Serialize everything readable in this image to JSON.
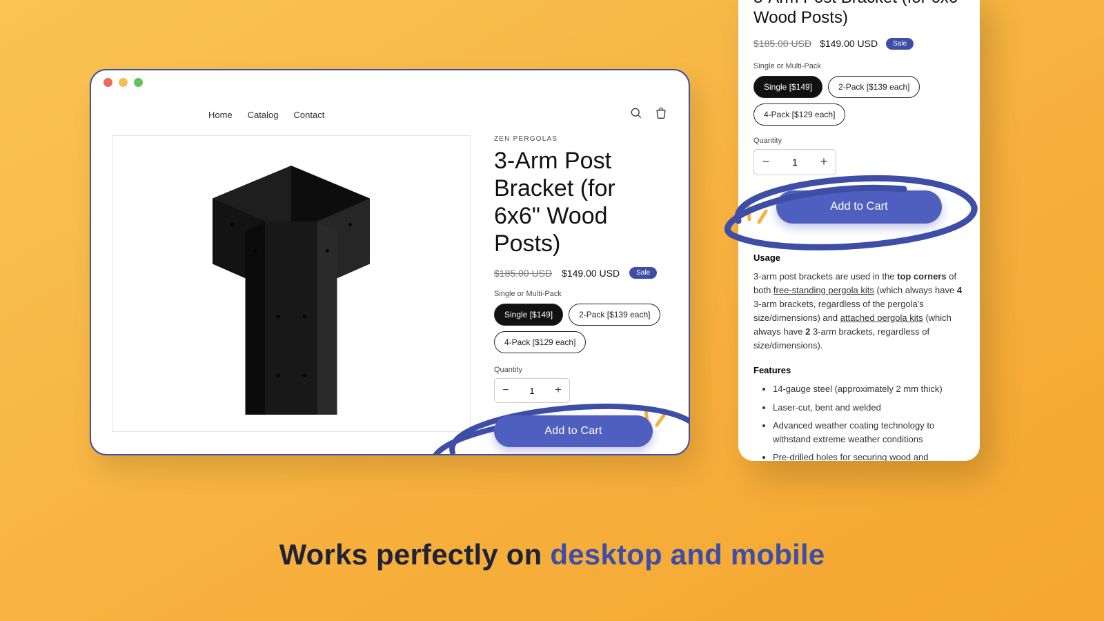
{
  "nav": {
    "home": "Home",
    "catalog": "Catalog",
    "contact": "Contact"
  },
  "product": {
    "vendor": "ZEN PERGOLAS",
    "title": "3-Arm Post Bracket (for 6x6\" Wood Posts)",
    "price_old": "$185.00 USD",
    "price_new": "$149.00 USD",
    "sale_badge": "Sale",
    "variant_label": "Single or Multi-Pack",
    "variants": {
      "single": "Single [$149]",
      "pack2": "2-Pack [$139 each]",
      "pack4": "4-Pack [$129 each]"
    },
    "qty_label": "Quantity",
    "qty_value": "1",
    "add_to_cart": "Add to Cart",
    "usage_heading": "Usage",
    "usage_lead": "3-arm post brackets are used in the ",
    "usage_bold1": "top corners",
    "usage_mid1": " of both ",
    "usage_link1": "free-standing pergola kits",
    "usage_tail_desktop": " (which always",
    "usage_mid2": " (which always have ",
    "usage_bold2": "4",
    "usage_mid3": " 3-arm brackets, regardless of the pergola's size/dimensions) and ",
    "usage_link2": "attached pergola kits",
    "usage_mid4": " (which always have ",
    "usage_bold3": "2",
    "usage_tail": " 3-arm brackets, regardless of size/dimensions).",
    "features_heading": "Features",
    "features": [
      "14-gauge steel (approximately 2 mm thick)",
      "Laser-cut, bent and welded",
      "Advanced weather coating technology to withstand extreme weather conditions",
      "Pre-drilled holes for securing wood and accessories to bracket"
    ]
  },
  "headline": {
    "lead": "Works perfectly on ",
    "accent": "desktop and mobile"
  }
}
